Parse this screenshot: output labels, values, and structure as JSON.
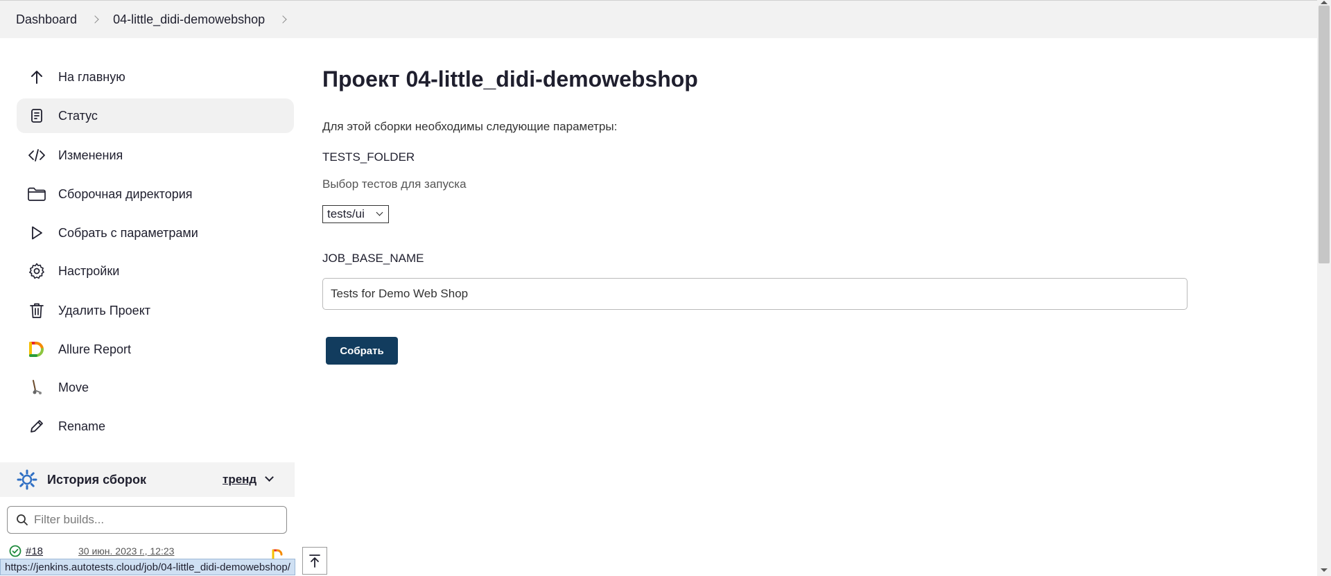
{
  "breadcrumb": {
    "items": [
      "Dashboard",
      "04-little_didi-demowebshop"
    ]
  },
  "sidebar": {
    "items": [
      {
        "label": "На главную",
        "icon": "arrow-up-icon"
      },
      {
        "label": "Статус",
        "icon": "document-icon",
        "active": true
      },
      {
        "label": "Изменения",
        "icon": "code-icon"
      },
      {
        "label": "Сборочная директория",
        "icon": "folder-icon"
      },
      {
        "label": "Собрать с параметрами",
        "icon": "play-icon"
      },
      {
        "label": "Настройки",
        "icon": "gear-icon"
      },
      {
        "label": "Удалить Проект",
        "icon": "trash-icon"
      },
      {
        "label": "Allure Report",
        "icon": "allure-icon"
      },
      {
        "label": "Move",
        "icon": "move-icon"
      },
      {
        "label": "Rename",
        "icon": "pencil-icon"
      }
    ]
  },
  "history": {
    "title": "История сборок",
    "trend_label": "тренд",
    "filter_placeholder": "Filter builds...",
    "builds": [
      {
        "number": "#18",
        "date": "30 июн. 2023 г., 12:23"
      }
    ]
  },
  "status_url": "https://jenkins.autotests.cloud/job/04-little_didi-demowebshop/",
  "main": {
    "title": "Проект 04-little_didi-demowebshop",
    "intro": "Для этой сборки необходимы следующие параметры:",
    "params": [
      {
        "name": "TESTS_FOLDER",
        "description": "Выбор тестов для запуска",
        "selected": "tests/ui"
      },
      {
        "name": "JOB_BASE_NAME",
        "value": "Tests for Demo Web Shop"
      }
    ],
    "build_button": "Собрать"
  },
  "colors": {
    "accent": "#123c5e",
    "sidebar_active": "#f1f1f1",
    "breadcrumb_bg": "#f2f2f2"
  }
}
